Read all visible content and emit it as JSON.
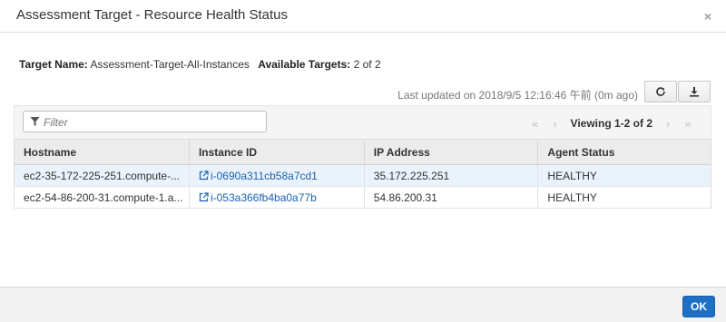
{
  "dialog": {
    "title": "Assessment Target - Resource Health Status",
    "close_symbol": "×"
  },
  "info": {
    "target_name_label": "Target Name:",
    "target_name_value": "Assessment-Target-All-Instances",
    "available_targets_label": "Available Targets:",
    "available_targets_value": "2 of 2"
  },
  "status": {
    "last_updated": "Last updated on 2018/9/5 12:16:46 午前 (0m ago)"
  },
  "toolbar": {
    "filter_placeholder": "Filter",
    "pager": {
      "first": "«",
      "prev": "‹",
      "viewing": "Viewing 1-2 of 2",
      "next": "›",
      "last": "»"
    }
  },
  "table": {
    "headers": [
      "Hostname",
      "Instance ID",
      "IP Address",
      "Agent Status"
    ],
    "rows": [
      {
        "hostname": "ec2-35-172-225-251.compute-...",
        "instance_id": "i-0690a311cb58a7cd1",
        "ip": "35.172.225.251",
        "agent_status": "HEALTHY"
      },
      {
        "hostname": "ec2-54-86-200-31.compute-1.a...",
        "instance_id": "i-053a366fb4ba0a77b",
        "ip": "54.86.200.31",
        "agent_status": "HEALTHY"
      }
    ]
  },
  "footer": {
    "ok_label": "OK"
  },
  "icons": {
    "close": "close-icon",
    "refresh": "refresh-icon",
    "download": "download-icon",
    "filter": "filter-icon",
    "external_link": "external-link-icon"
  },
  "colors": {
    "link": "#1a62b0",
    "primary_button": "#1f6fc5",
    "selected_row": "#eaf3fb"
  }
}
